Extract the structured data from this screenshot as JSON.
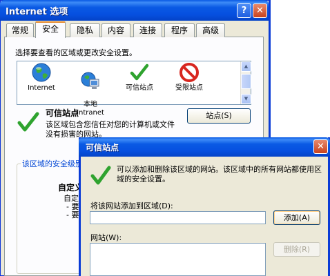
{
  "window": {
    "title": "Internet 选项",
    "help_label": "?",
    "close_label": "✕"
  },
  "tabs": [
    {
      "label": "常规"
    },
    {
      "label": "安全"
    },
    {
      "label": "隐私"
    },
    {
      "label": "内容"
    },
    {
      "label": "连接"
    },
    {
      "label": "程序"
    },
    {
      "label": "高级"
    }
  ],
  "security": {
    "prompt": "选择要查看的区域或更改安全设置。",
    "zones": [
      {
        "label": "Internet",
        "icon": "globe-icon"
      },
      {
        "label": "本地\nIntranet",
        "icon": "intranet-icon"
      },
      {
        "label": "可信站点",
        "icon": "check-icon"
      },
      {
        "label": "受限站点",
        "icon": "restricted-icon"
      }
    ],
    "zone_heading": "可信站点",
    "zone_description": "该区域包含您信任对您的计算机或文件没有损害的网站。",
    "sites_button": "站点(S)",
    "level_group_label": "该区域的安全级别",
    "custom_title": "自定义",
    "custom_lines": [
      "自定",
      "- 要",
      "- 要"
    ]
  },
  "dialog": {
    "title": "可信站点",
    "close_label": "✕",
    "description": "可以添加和删除该区域的网站。该区域中的所有网站都使用区域的安全设置。",
    "add_label": "将该网站添加到区域(D):",
    "add_input_value": "",
    "add_button": "添加(A)",
    "websites_label": "网站(W):",
    "remove_button": "删除(R)"
  },
  "colors": {
    "titlebar": "#0a5ae4",
    "dialog_bg": "#ece9d8",
    "panel_bg": "#fcfcfe",
    "check_green": "#2fa32f",
    "restricted_red": "#d8261f"
  }
}
